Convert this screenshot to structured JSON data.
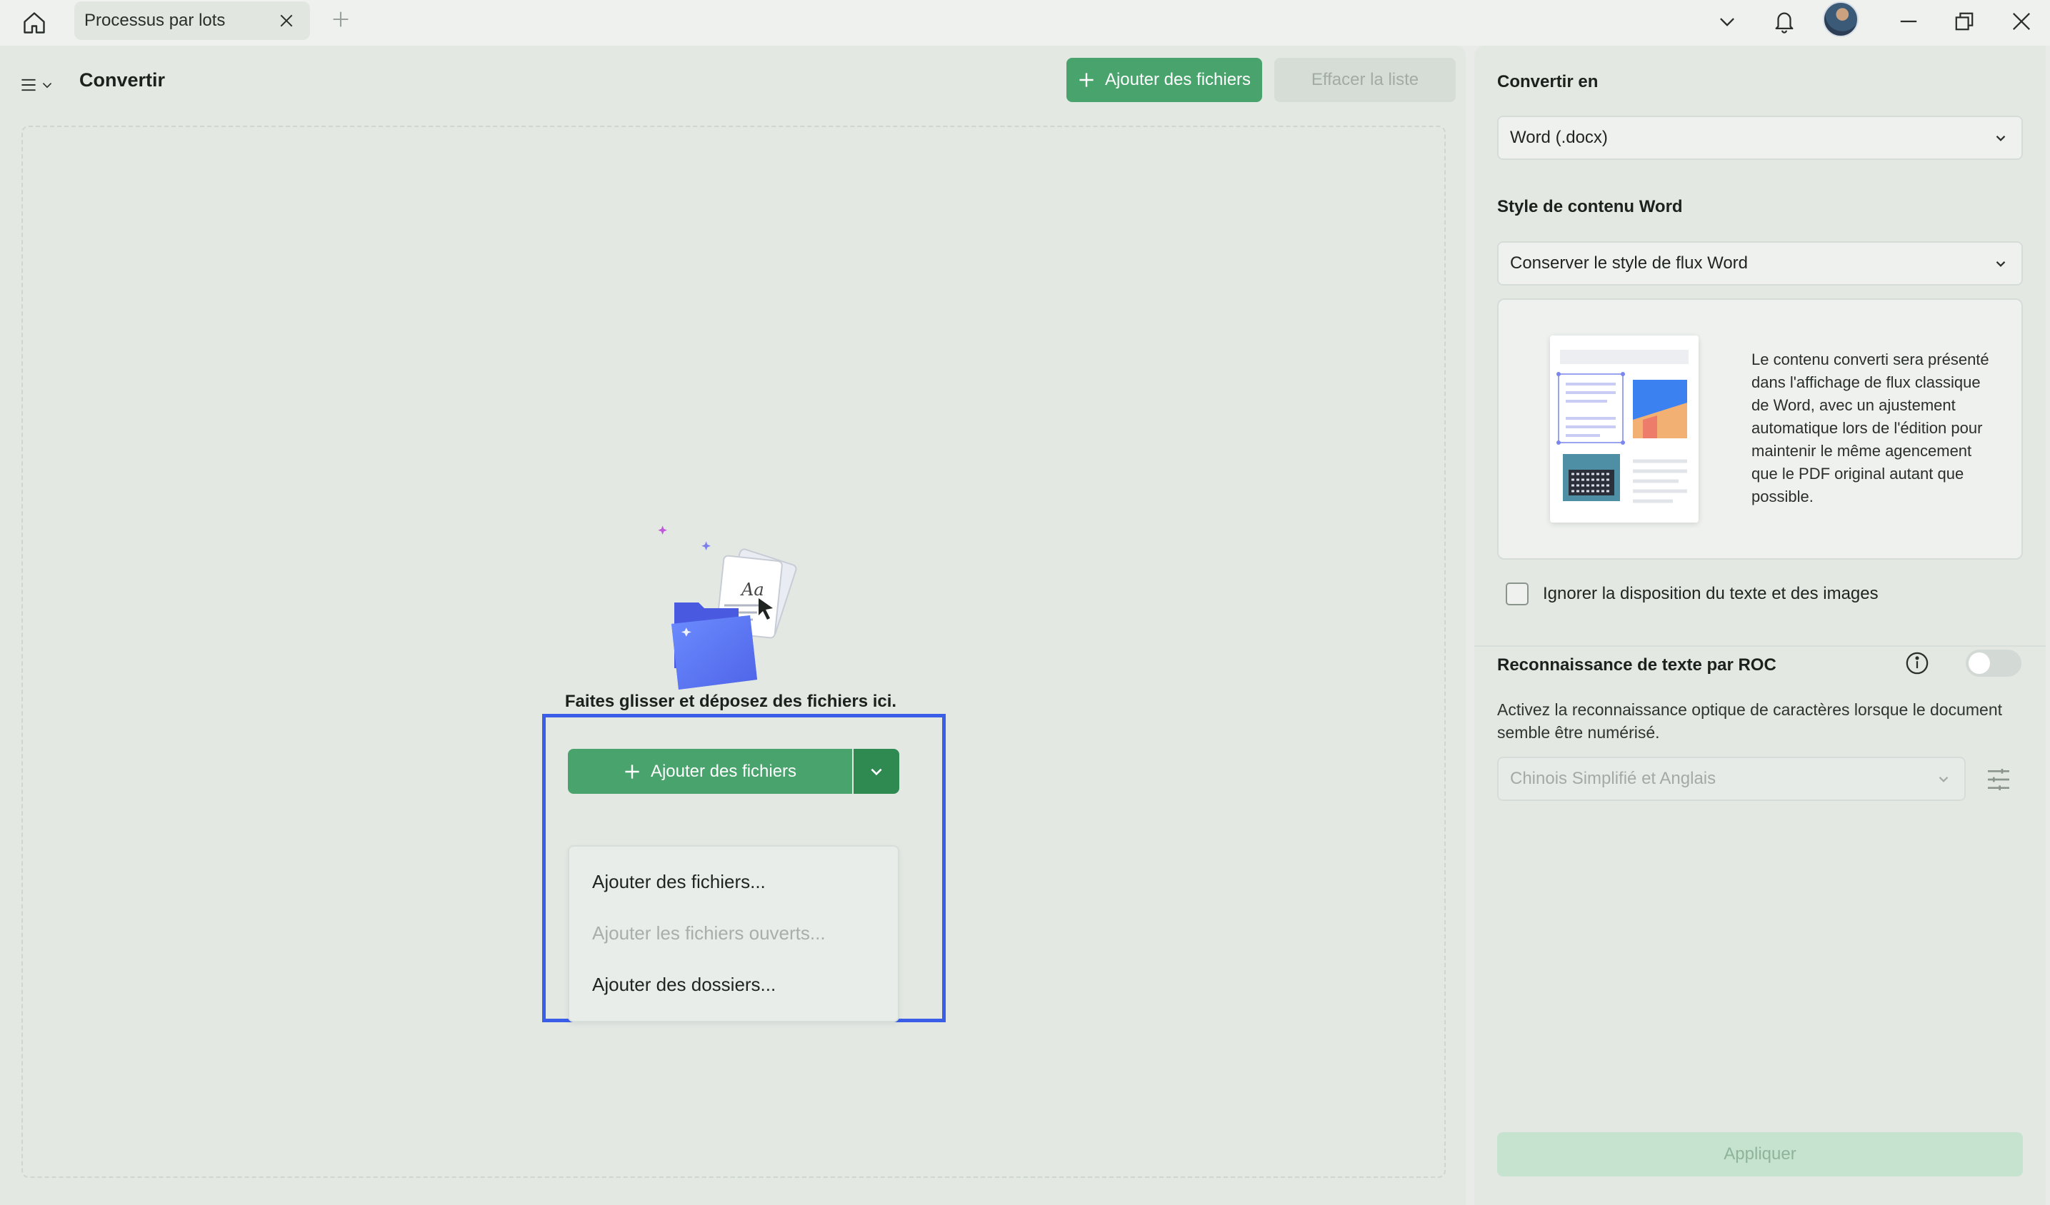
{
  "titlebar": {
    "tab_label": "Processus par lots",
    "home_icon": "home-icon",
    "close_tab_icon": "close-icon",
    "new_tab_icon": "plus-icon",
    "icons": [
      "chevron-down-icon",
      "bell-icon",
      "avatar",
      "minimize-icon",
      "restore-icon",
      "close-icon"
    ]
  },
  "toolbar": {
    "title": "Convertir",
    "add_files_label": "Ajouter des fichiers",
    "clear_list_label": "Effacer la liste"
  },
  "dropzone": {
    "instruction": "Faites glisser et déposez des fichiers ici.",
    "add_button_label": "Ajouter des fichiers",
    "menu_items": [
      {
        "label": "Ajouter des fichiers...",
        "enabled": true
      },
      {
        "label": "Ajouter les fichiers ouverts...",
        "enabled": false
      },
      {
        "label": "Ajouter des dossiers...",
        "enabled": true
      }
    ]
  },
  "settings": {
    "convert_to_label": "Convertir en",
    "convert_to_value": "Word (.docx)",
    "style_label": "Style de contenu Word",
    "style_value": "Conserver le style de flux Word",
    "style_description": "Le contenu converti sera présenté dans l'affichage de flux classique de Word, avec un ajustement automatique lors de l'édition pour maintenir le même agencement que le PDF original autant que possible.",
    "ignore_layout_label": "Ignorer la disposition du texte et des images",
    "ignore_layout_checked": false,
    "ocr_label": "Reconnaissance de texte par ROC",
    "ocr_enabled": false,
    "ocr_description": "Activez la reconnaissance optique de caractères lorsque le document semble être numérisé.",
    "ocr_language": "Chinois Simplifié et Anglais",
    "apply_label": "Appliquer"
  },
  "colors": {
    "accent": "#48a36c",
    "accent_dark": "#2f8a52",
    "highlight": "#3a5ee8",
    "panel": "#e3e8e3"
  }
}
